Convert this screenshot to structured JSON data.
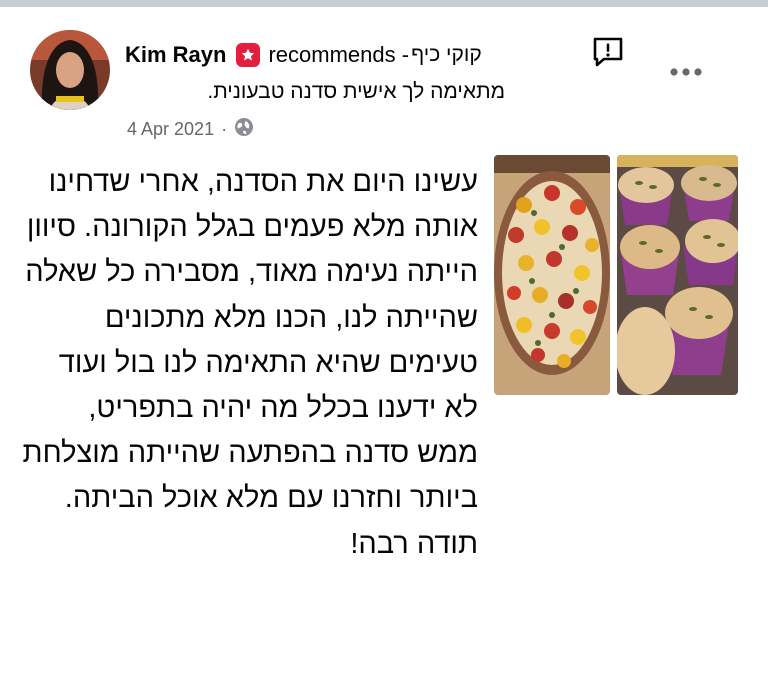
{
  "post": {
    "author": "Kim Rayn",
    "action": "recommends -",
    "page": "קוקי כיף",
    "tagline": "מתאימה לך אישית סדנה טבעונית.",
    "date": "4 Apr 2021",
    "separator": "·",
    "privacy_icon": "globe-icon",
    "body": "עשינו היום את הסדנה, אחרי שדחינו אותה מלא פעמים בגלל הקורונה. סיוון הייתה נעימה מאוד, מסבירה כל שאלה שהייתה לנו, הכנו מלא מתכונים טעימים שהיא התאימה לנו בול ועוד לא ידענו בכלל מה יהיה בתפריט, ממש סדנה בהפתעה שהייתה מוצלחת ביותר וחזרנו עם מלא אוכל הביתה.",
    "thanks": "תודה רבה!",
    "photos": [
      "tart-photo",
      "muffins-photo"
    ]
  },
  "icons": {
    "recommend": "recommend-badge-icon",
    "report": "report-icon",
    "more": "more-options-icon"
  },
  "colors": {
    "recommend_badge": "#e41e3f",
    "secondary_text": "#65676b",
    "top_bar": "#c9ccd1"
  }
}
